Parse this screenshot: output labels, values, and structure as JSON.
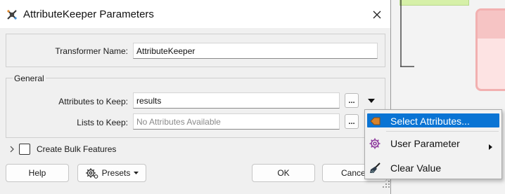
{
  "dialog": {
    "title": "AttributeKeeper Parameters",
    "transformer_name_label": "Transformer Name:",
    "transformer_name_value": "AttributeKeeper",
    "general_label": "General",
    "attributes_to_keep_label": "Attributes to Keep:",
    "attributes_to_keep_value": "results",
    "lists_to_keep_label": "Lists to Keep:",
    "lists_to_keep_placeholder": "No Attributes Available",
    "dots_label": "...",
    "create_bulk_label": "Create Bulk Features",
    "create_bulk_checked": false
  },
  "buttons": {
    "help": "Help",
    "presets": "Presets",
    "ok": "OK",
    "cancel": "Cancel"
  },
  "context_menu": {
    "items": [
      {
        "label": "Select Attributes...",
        "icon": "orange-arrow-icon",
        "highlighted": true
      },
      {
        "label": "User Parameter",
        "icon": "gear-icon",
        "has_submenu": true
      },
      {
        "label": "Clear Value",
        "icon": "broom-icon"
      }
    ]
  },
  "colors": {
    "highlight": "#0a74d4",
    "param_icon": "#8e3c9e",
    "select_icon": "#d9832b"
  }
}
